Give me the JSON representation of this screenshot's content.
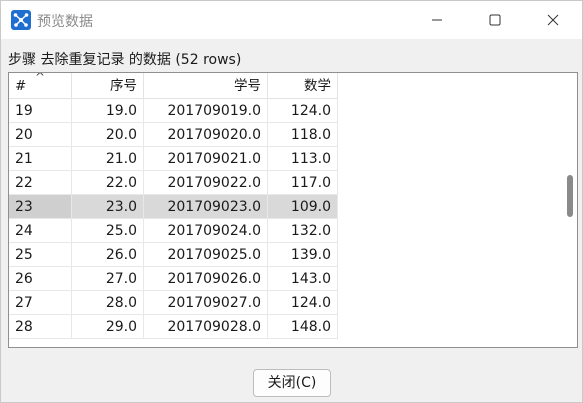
{
  "window": {
    "title": "预览数据",
    "icon": "app-logo-icon",
    "controls": [
      "minimize-icon",
      "maximize-icon",
      "close-icon"
    ]
  },
  "caption": "步骤 去除重复记录 的数据  (52 rows)",
  "table": {
    "columns": [
      "#",
      "序号",
      "学号",
      "数学"
    ],
    "sort_indicator": "^",
    "selected_row_index": 4,
    "rows": [
      [
        "19",
        "19.0",
        "201709019.0",
        "124.0"
      ],
      [
        "20",
        "20.0",
        "201709020.0",
        "118.0"
      ],
      [
        "21",
        "21.0",
        "201709021.0",
        "113.0"
      ],
      [
        "22",
        "22.0",
        "201709022.0",
        "117.0"
      ],
      [
        "23",
        "23.0",
        "201709023.0",
        "109.0"
      ],
      [
        "24",
        "25.0",
        "201709024.0",
        "132.0"
      ],
      [
        "25",
        "26.0",
        "201709025.0",
        "139.0"
      ],
      [
        "26",
        "27.0",
        "201709026.0",
        "143.0"
      ],
      [
        "27",
        "28.0",
        "201709027.0",
        "124.0"
      ],
      [
        "28",
        "29.0",
        "201709028.0",
        "148.0"
      ]
    ]
  },
  "buttons": {
    "close_label": "关闭(C)"
  },
  "colors": {
    "selected_row": "#d9d9d9",
    "app_icon": "#1f6fd1"
  }
}
